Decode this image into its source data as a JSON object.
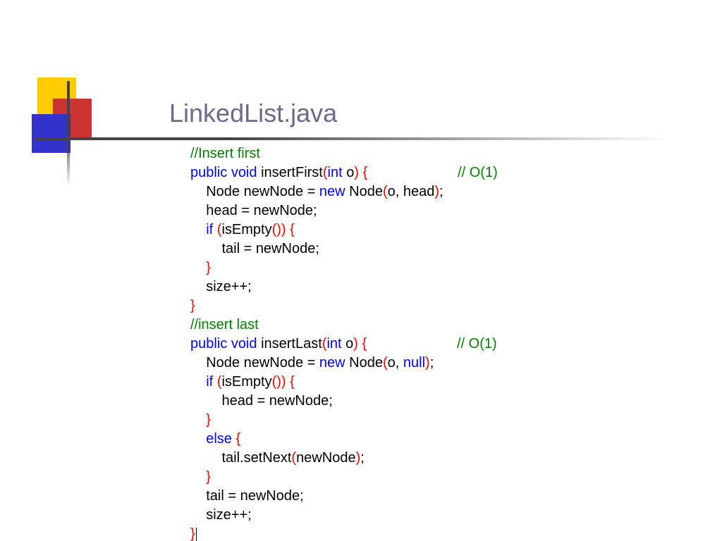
{
  "title": "LinkedList.java",
  "code": {
    "c1": "//Insert first",
    "l2_kw": "public void",
    "l2_name": " insertFirst",
    "l2_p1": "(",
    "l2_int": "int",
    "l2_arg": " o",
    "l2_p2": ") {",
    "l2_cm": "// O(1)",
    "l3_a": "    Node newNode = ",
    "l3_new": "new",
    "l3_b": " Node",
    "l3_p1": "(",
    "l3_c": "o, head",
    "l3_p2": ")",
    "l3_semi": ";",
    "l4": "    head = newNode;",
    "l5_if": "    if",
    "l5_sp": " ",
    "l5_p1": "(",
    "l5_call": "isEmpty",
    "l5_p2": "()) {",
    "l6": "        tail = newNode;",
    "l7_p": "    }",
    "l8": "    size++;",
    "l9_p": "}",
    "c2": "//insert last",
    "l11_kw": "public void",
    "l11_name": " insertLast",
    "l11_p1": "(",
    "l11_int": "int",
    "l11_arg": " o",
    "l11_p2": ") {",
    "l11_cm": "// O(1)",
    "l12_a": "    Node newNode = ",
    "l12_new": "new",
    "l12_b": " Node",
    "l12_p1": "(",
    "l12_c": "o, ",
    "l12_null": "null",
    "l12_p2": ")",
    "l12_semi": ";",
    "l13_if": "    if",
    "l13_sp": " ",
    "l13_p1": "(",
    "l13_call": "isEmpty",
    "l13_p2": "()) {",
    "l14": "        head = newNode;",
    "l15_p": "    }",
    "l16_else": "    else",
    "l16_sp": " ",
    "l16_br": "{",
    "l17_a": "        tail.setNext",
    "l17_p1": "(",
    "l17_b": "newNode",
    "l17_p2": ")",
    "l17_semi": ";",
    "l18_p": "    }",
    "l19": "    tail = newNode;",
    "l20": "    size++;",
    "l21_p": "}"
  }
}
